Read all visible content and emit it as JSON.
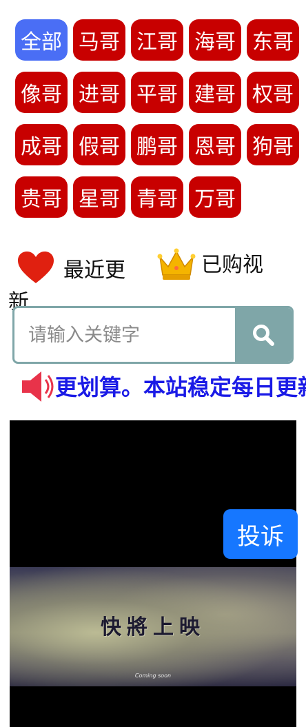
{
  "categories": [
    {
      "label": "全部",
      "active": true
    },
    {
      "label": "马哥"
    },
    {
      "label": "江哥"
    },
    {
      "label": "海哥"
    },
    {
      "label": "东哥"
    },
    {
      "label": "像哥"
    },
    {
      "label": "进哥"
    },
    {
      "label": "平哥"
    },
    {
      "label": "建哥"
    },
    {
      "label": "权哥"
    },
    {
      "label": "成哥"
    },
    {
      "label": "假哥"
    },
    {
      "label": "鹏哥"
    },
    {
      "label": "恩哥"
    },
    {
      "label": "狗哥"
    },
    {
      "label": "贵哥"
    },
    {
      "label": "星哥"
    },
    {
      "label": "青哥"
    },
    {
      "label": "万哥"
    }
  ],
  "quick_links": {
    "recent": {
      "label": "最近更新",
      "icon": "heart-icon"
    },
    "purchased": {
      "label": "已购视",
      "icon": "crown-icon"
    }
  },
  "search": {
    "placeholder": "请输入关键字",
    "value": "",
    "icon": "search-icon"
  },
  "notice": {
    "text": "更划算。本站稳定每日更新",
    "icon": "speaker-icon"
  },
  "video": {
    "poster_title": "快將上映",
    "poster_subtitle": "Coming soon"
  },
  "complaint": {
    "label": "投诉"
  },
  "colors": {
    "chip": "#c80000",
    "chip_active": "#4a6ef5",
    "search_border": "#7fa6a8",
    "notice_text": "#1a1ae6",
    "complaint_button": "#1677ff"
  }
}
